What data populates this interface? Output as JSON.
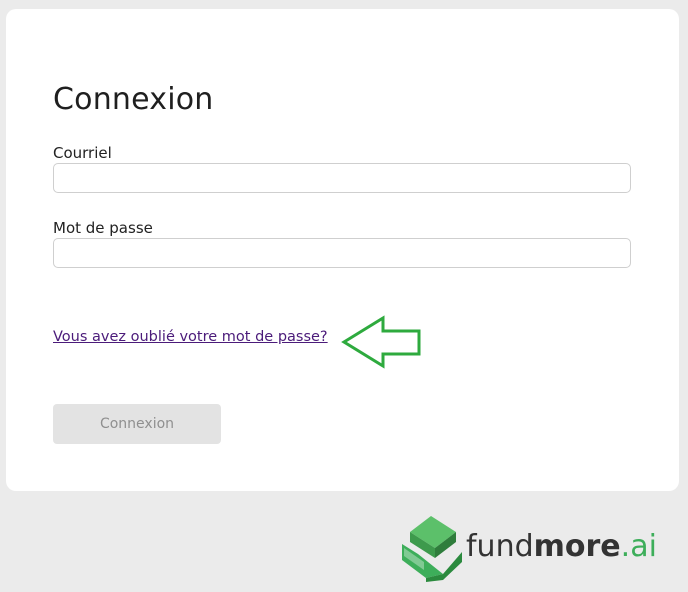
{
  "login": {
    "title": "Connexion",
    "email_label": "Courriel",
    "email_value": "",
    "password_label": "Mot de passe",
    "password_value": "",
    "forgot_link": "Vous avez oublié votre mot de passe?",
    "submit_label": "Connexion"
  },
  "annotation": {
    "arrow_icon": "left-arrow-icon",
    "arrow_color": "#2eaa3e"
  },
  "brand": {
    "logo_icon": "fundmore-logo-icon",
    "name_light": "fund",
    "name_bold": "more",
    "name_suffix": ".ai",
    "accent_color": "#3dae5a"
  }
}
